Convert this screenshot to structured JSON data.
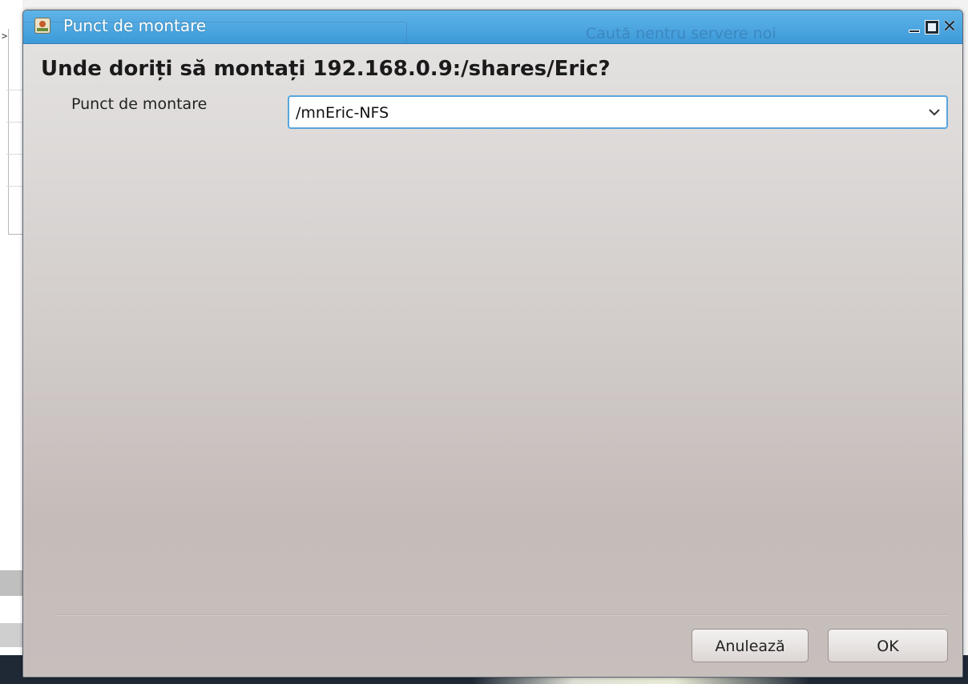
{
  "window": {
    "title": "Punct de montare",
    "background_title_ghost": "Caută nentru servere noi"
  },
  "dialog": {
    "question": "Unde doriți să montați 192.168.0.9:/shares/Eric?",
    "field_label": "Punct de montare",
    "mount_point_value": "/mnEric-NFS"
  },
  "buttons": {
    "cancel_label": "Anulează",
    "ok_label": "OK"
  },
  "colors": {
    "titlebar": "#3d9ad8",
    "focus_border": "#58a6dd"
  }
}
